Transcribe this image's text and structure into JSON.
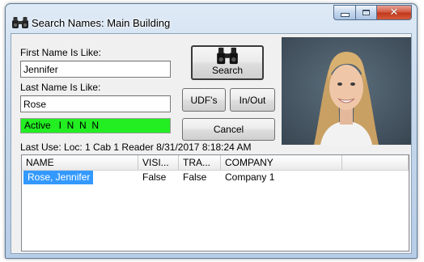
{
  "window": {
    "title": "Search Names: Main Building",
    "controls": {
      "minimize": "minimize",
      "maximize": "maximize",
      "close": "close"
    }
  },
  "form": {
    "first_name_label": "First Name Is Like:",
    "first_name_value": "Jennifer",
    "last_name_label": "Last Name Is Like:",
    "last_name_value": "Rose",
    "status_text": "Active   I  N  N  N",
    "status_color": "#22ee22",
    "last_use": "Last Use: Loc: 1  Cab 1 Reader  8/31/2017 8:18:24 AM"
  },
  "buttons": {
    "search": "Search",
    "udfs": "UDF's",
    "in_out": "In/Out",
    "cancel": "Cancel"
  },
  "icons": {
    "title_icon": "binoculars-icon",
    "search_icon": "binoculars-icon"
  },
  "results": {
    "columns": [
      "NAME",
      "VISI...",
      "TRA...",
      "COMPANY"
    ],
    "rows": [
      {
        "name": "Rose, Jennifer",
        "visitor": "False",
        "tra": "False",
        "company": "Company 1",
        "selected": true
      }
    ]
  },
  "colors": {
    "selection": "#3399ff",
    "close_button": "#c94a30"
  }
}
